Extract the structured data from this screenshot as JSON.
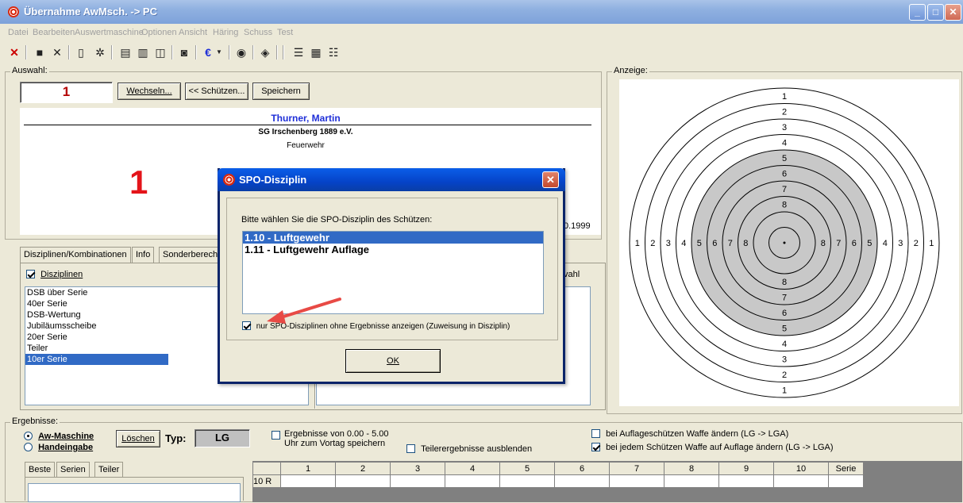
{
  "window": {
    "title": "Übernahme AwMsch. -> PC"
  },
  "menu": [
    "Datei",
    "Bearbeiten",
    "Auswertmaschine",
    "Optionen",
    "Ansicht",
    "Häring",
    "Schuss",
    "Test"
  ],
  "auswahl": {
    "label": "Auswahl:",
    "number": "1",
    "wechseln": "Wechseln...",
    "schuetzen": "<< Schützen...",
    "speichern": "Speichern"
  },
  "shooter": {
    "name": "Thurner, Martin",
    "club": "SG Irschenberg 1889 e.V.",
    "category": "Feuerwehr",
    "big_number": "1",
    "year_fragment": "0.1999"
  },
  "tabs": [
    "Disziplinen/Kombinationen",
    "Info",
    "Sonderberech"
  ],
  "disciplines": {
    "checkbox_label": "Disziplinen",
    "items": [
      "DSB über Serie",
      "40er Serie",
      "DSB-Wertung",
      "Jubiläumsscheibe",
      "20er Serie",
      "Teiler",
      "10er Serie"
    ],
    "selected_index": 6,
    "right_fragment": "vahl"
  },
  "anzeige": {
    "label": "Anzeige:",
    "ring_numbers": [
      "1",
      "2",
      "3",
      "4",
      "5",
      "6",
      "7",
      "8"
    ]
  },
  "dialog": {
    "title": "SPO-Disziplin",
    "prompt": "Bitte wählen Sie die SPO-Disziplin des Schützen:",
    "options": [
      "1.10 - Luftgewehr",
      "1.11 - Luftgewehr Auflage"
    ],
    "selected_index": 0,
    "checkbox_label": "nur SPO-Disziplinen ohne Ergebnisse anzeigen (Zuweisung in Disziplin)",
    "ok": "OK"
  },
  "ergebnisse": {
    "label": "Ergebnisse:",
    "radio_aw": "Aw-Maschine",
    "radio_hand": "Handeingabe",
    "loeschen": "Löschen",
    "typ_label": "Typ:",
    "typ_value": "LG",
    "opt_range": "Ergebnisse von 0.00 - 5.00",
    "opt_save": "Uhr zum Vortag speichern",
    "opt_teiler": "Teilerergebnisse ausblenden",
    "opt_auflage1": "bei Auflageschützen Waffe ändern (LG -> LGA)",
    "opt_auflage2": "bei jedem Schützen Waffe auf Auflage ändern (LG -> LGA)"
  },
  "result_tabs": [
    "Beste",
    "Serien",
    "Teiler"
  ],
  "grid": {
    "headers": [
      "1",
      "2",
      "3",
      "4",
      "5",
      "6",
      "7",
      "8",
      "9",
      "10",
      "Serie"
    ],
    "row_label": "10 R"
  },
  "colors": {
    "accent_blue": "#1f2fd8",
    "dark_red": "#b40000",
    "selection": "#316ac5",
    "arrow": "#e84a45"
  }
}
